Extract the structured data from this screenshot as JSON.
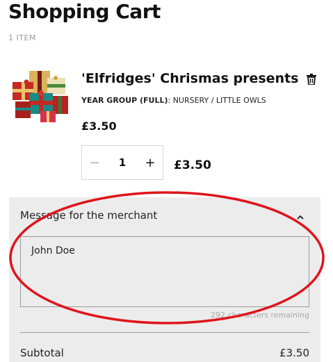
{
  "header": {
    "title": "Shopping Cart",
    "item_count": "1 ITEM"
  },
  "item": {
    "name": "'Elfridges' Chrismas presents",
    "option_key": "YEAR GROUP (FULL)",
    "option_value": ": NURSERY / LITTLE OWLS",
    "price": "£3.50",
    "quantity": "1",
    "line_total": "£3.50",
    "image_icon": "gift-boxes-image",
    "delete_icon": "trash-icon"
  },
  "note_panel": {
    "title": "Message for the merchant",
    "message": "John Doe",
    "chars_remaining": "292 characters remaining",
    "toggle_icon": "chevron-up-icon"
  },
  "summary": {
    "subtotal_label": "Subtotal",
    "subtotal_value": "£3.50"
  },
  "colors": {
    "panel_bg": "#ececec",
    "annotation_red": "#e0141c",
    "text": "#111111"
  }
}
